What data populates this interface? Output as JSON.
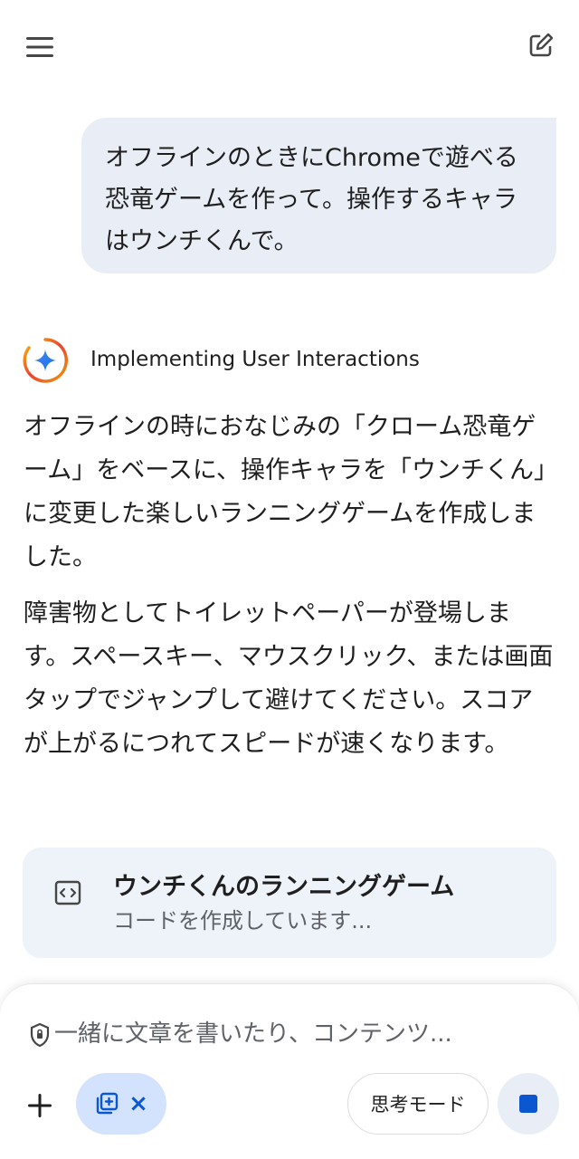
{
  "header": {
    "menu_icon": "hamburger-menu-icon",
    "new_chat_icon": "edit-square-icon"
  },
  "user_message": {
    "text": "オフラインのときにChromeで遊べる恐竜ゲームを作って。操作するキャラはウンチくんで。"
  },
  "assistant": {
    "status_title": "Implementing User Interactions",
    "paragraphs": [
      "オフラインの時におなじみの「クローム恐竜ゲーム」をベースに、操作キャラを「ウンチくん」に変更した楽しいランニングゲームを作成しました。",
      "障害物としてトイレットペーパーが登場します。スペースキー、マウスクリック、または画面タップでジャンプして避けてください。スコアが上がるにつれてスピードが速くなります。"
    ],
    "code_card": {
      "title": "ウンチくんのランニングゲーム",
      "subtitle": "コードを作成しています...",
      "icon": "code-brackets-icon"
    }
  },
  "input": {
    "placeholder": "一緒に文章を書いたり、コンテンツ...",
    "mode_label": "思考モード",
    "chip_close": "×"
  },
  "colors": {
    "accent": "#0b57d0",
    "bubble": "#e9eef6",
    "card": "#eef2f9",
    "chip": "#d3e3fd"
  }
}
